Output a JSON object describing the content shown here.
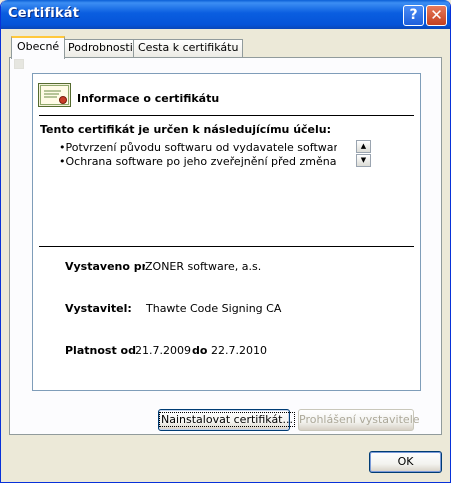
{
  "window": {
    "title": "Certifikát"
  },
  "tabs": [
    {
      "label": "Obecné"
    },
    {
      "label": "Podrobnosti"
    },
    {
      "label": "Cesta k certifikátu"
    }
  ],
  "info": {
    "heading": "Informace o certifikátu",
    "purpose_heading": "Tento certifikát je určen k následujícímu účelu:",
    "purposes": [
      "•Potvrzení původu softwaru od vydavatele softwaru",
      "•Ochrana software po jeho zveřejnění před změnami"
    ],
    "issued_to_label": "Vystaveno pro:",
    "issued_to_value": "ZONER software, a.s.",
    "issuer_label": "Vystavitel:",
    "issuer_value": "Thawte Code Signing CA",
    "valid_label": "Platnost od",
    "valid_from": "21.7.2009",
    "valid_to_label": "do",
    "valid_to": "22.7.2010"
  },
  "buttons": {
    "install": "Nainstalovat certifikát...",
    "issuer_statement": "Prohlášení vystavitele",
    "ok": "OK"
  },
  "icons": {
    "help": "help-icon",
    "close": "close-icon",
    "certificate": "certificate-icon"
  }
}
